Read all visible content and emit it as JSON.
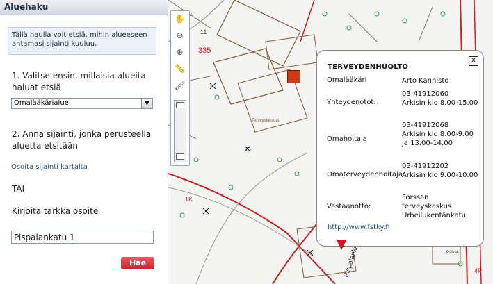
{
  "panel": {
    "title": "Aluehaku",
    "info": "Tällä haulla voit etsiä, mihin alueeseen antamasi sijainti kuuluu.",
    "step1": "1. Valitse ensin, millaisia alueita haluat etsiä",
    "select_value": "Omalääkärialue",
    "step2": "2. Anna sijainti, jonka perusteella aluetta etsitään",
    "map_link": "Osoita sijainti kartalta",
    "or": "TAI",
    "address_label": "Kirjoita tarkka osoite",
    "address_value": "Pispalankatu 1",
    "search_button": "Hae"
  },
  "map": {
    "labels": {
      "l335": "335",
      "l11": "11",
      "l1k": "1K",
      "l4p": "4P",
      "street": "Pispalankatu",
      "health": "Terveyskeskus",
      "paivak": "Päivak"
    }
  },
  "toolbar": {
    "pan": "pan-hand-icon",
    "zoom_out": "zoom-out-icon",
    "zoom_in": "zoom-in-icon",
    "measure": "ruler-icon",
    "draw": "brush-icon",
    "zoom_home": "zoom-reset-icon"
  },
  "popup": {
    "title": "TERVEYDENHUOLTO",
    "rows": [
      {
        "label": "Omalääkäri",
        "value": "Arto Kannisto"
      },
      {
        "label": "Yhteydenotot:",
        "value": "03-41912060\nArkisin klo 8.00-15.00"
      },
      {
        "label": "Omahoitaja",
        "value": "03-41912068\nArkisin klo 8.00-9.00 ja 13.00-14.00"
      },
      {
        "label": "Omaterveydenhoitaja",
        "value": "03-41912202\nArkisin klo 9.00-10.00"
      },
      {
        "label": "Vastaanotto:",
        "value": "Forssan terveyskeskus Urheilukentänkatu"
      }
    ],
    "url": "http://www.fstky.fi",
    "close": "X"
  },
  "colors": {
    "accent": "#c8202e",
    "link": "#1e5096",
    "map_red": "#cc1f1f",
    "map_green": "#2ea44f",
    "map_brown": "#8a5a3a"
  }
}
